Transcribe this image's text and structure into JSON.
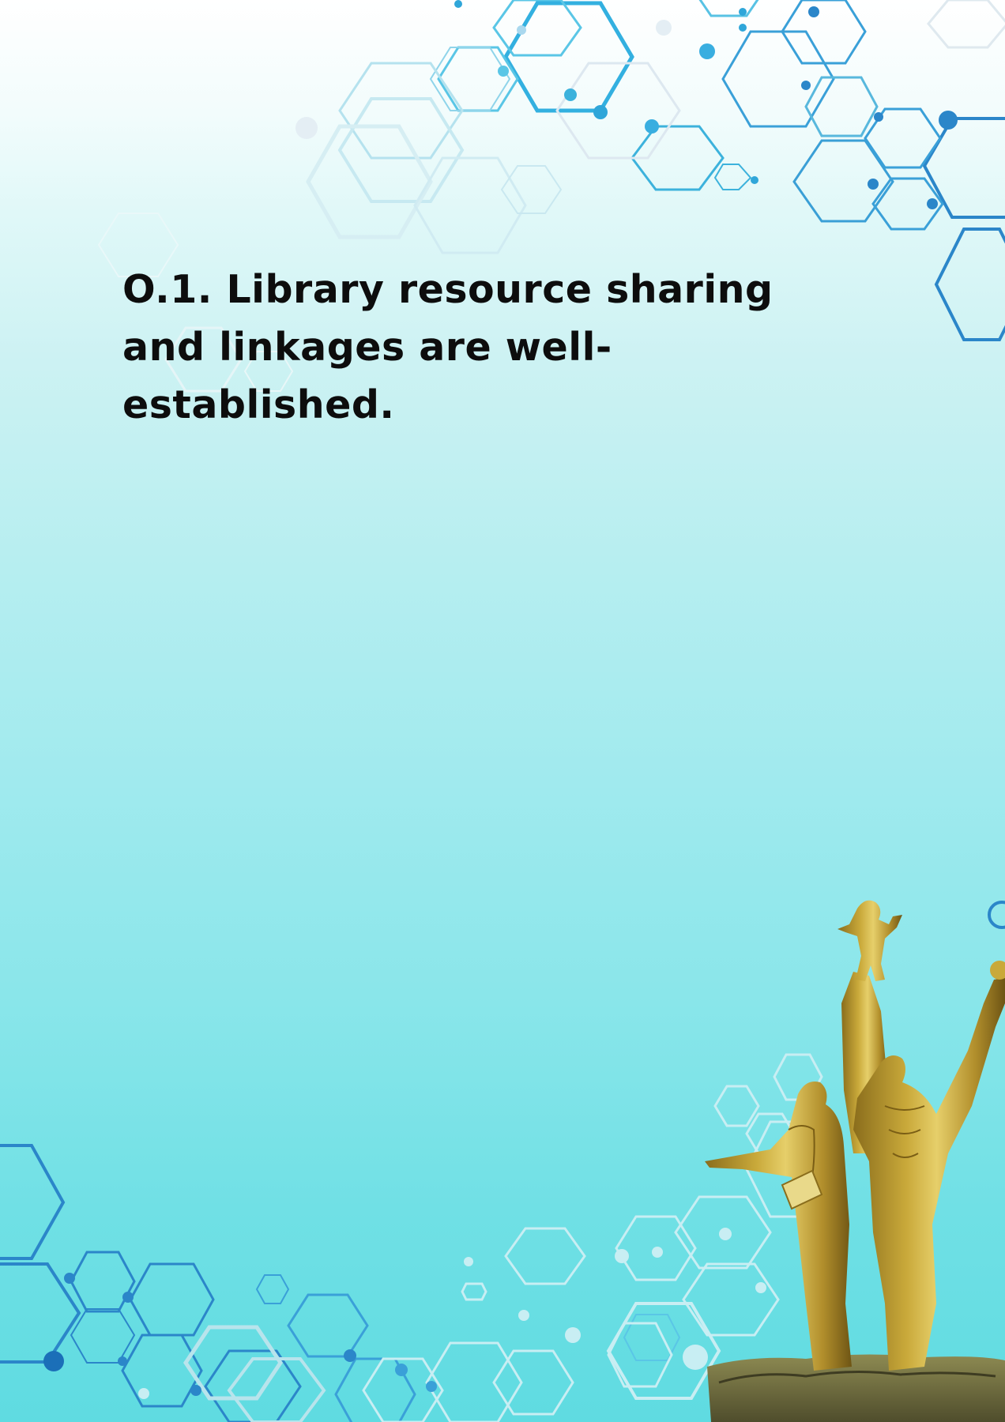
{
  "document": {
    "heading": "O.1. Library resource sharing and linkages are well-established."
  },
  "colors": {
    "background_top": "#ffffff",
    "background_bottom": "#5fdbe1",
    "hex_primary": "#2fa6d9",
    "hex_secondary": "#1b6fb8",
    "hex_faint": "#9fd8e8",
    "statue_gold": "#c9a93a"
  },
  "decorations": {
    "top_right": "hexagon-network-pattern",
    "bottom_left": "hexagon-network-pattern",
    "bottom_right": "golden-monument-statue"
  }
}
